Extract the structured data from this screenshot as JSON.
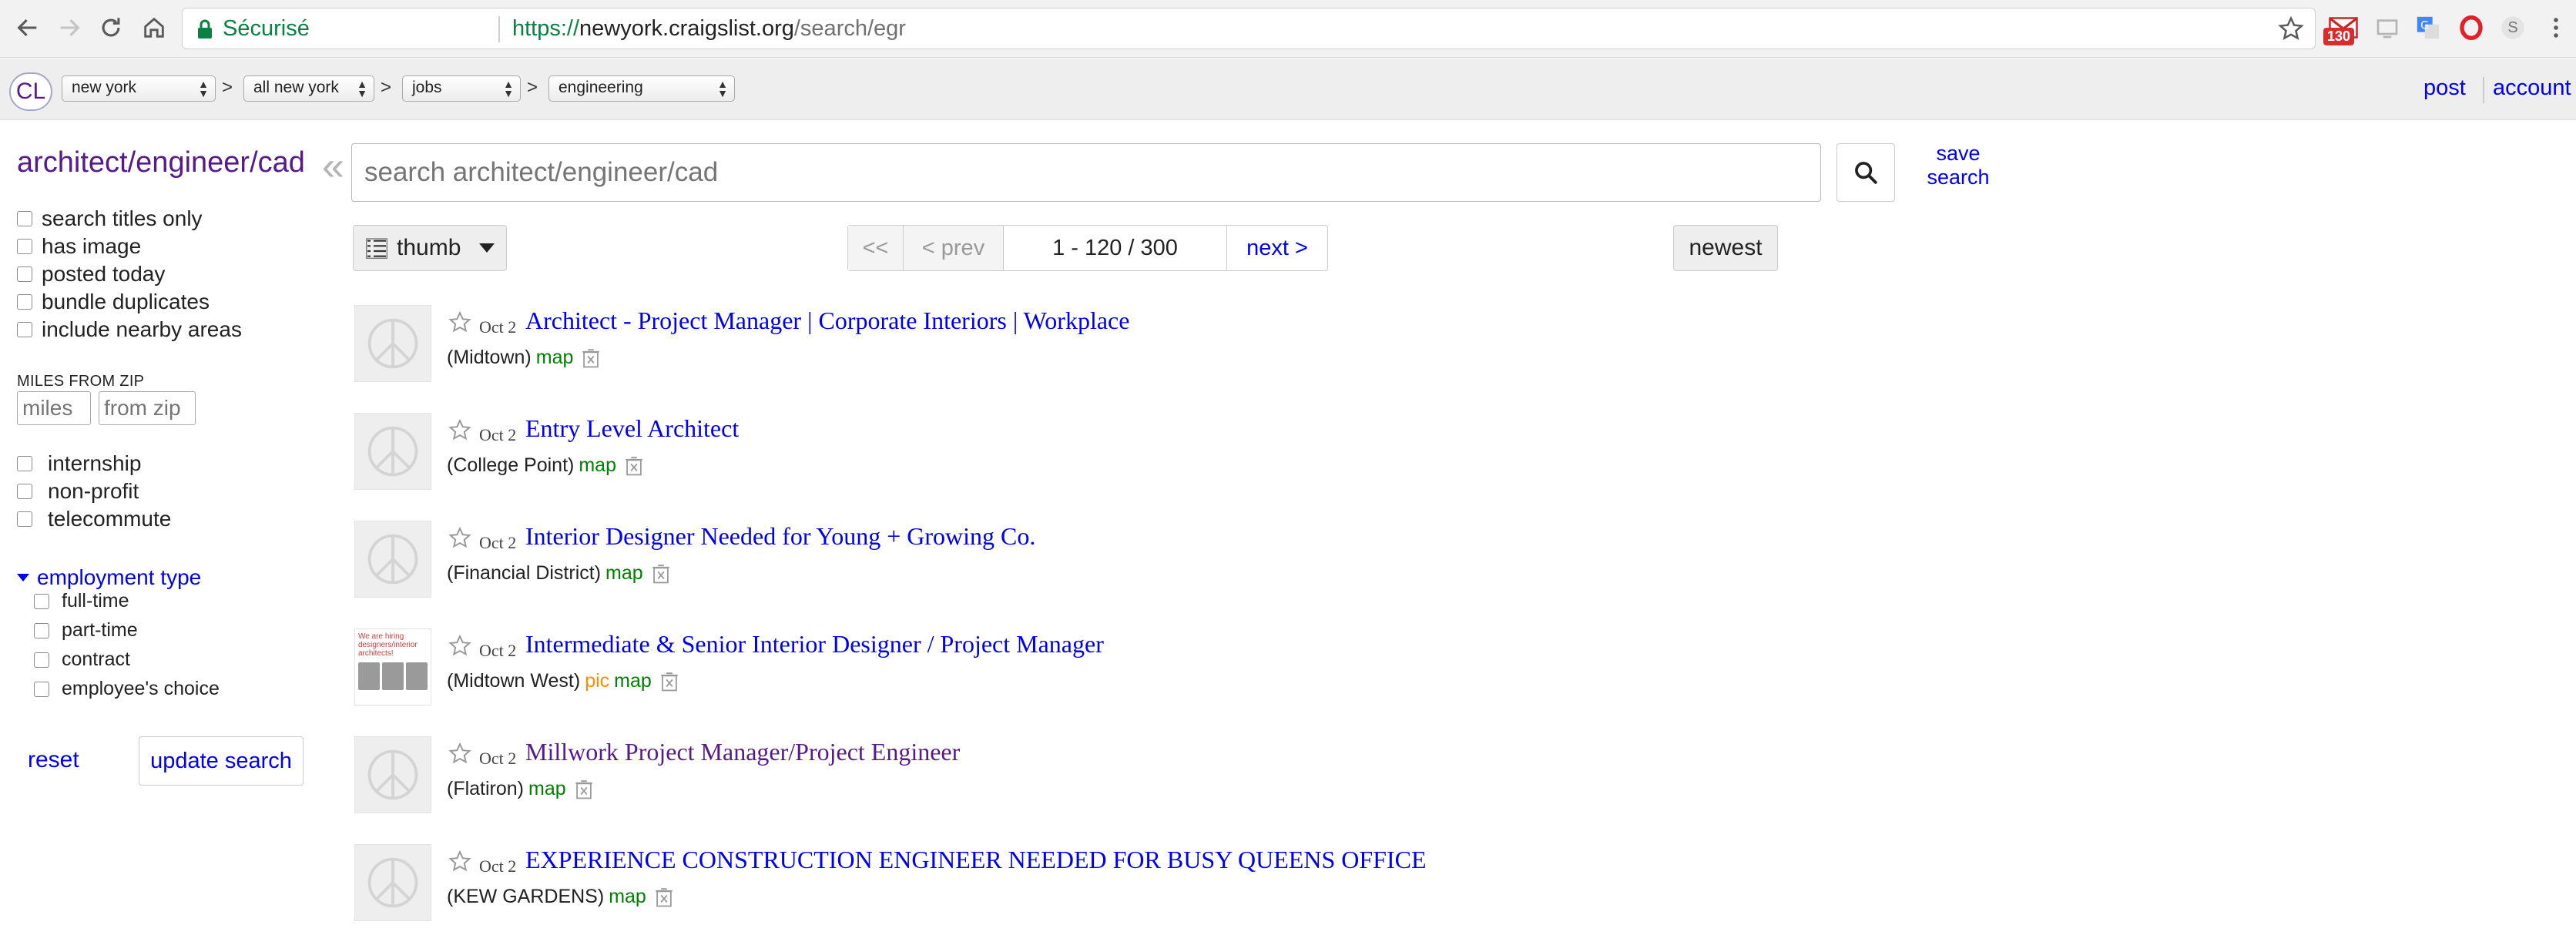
{
  "browser": {
    "secure_label": "Sécurisé",
    "url_scheme": "https://",
    "url_host": "newyork.craigslist.org",
    "url_path": "/search/egr",
    "gmail_count": "130",
    "profile_initial": "S"
  },
  "header": {
    "logo": "CL",
    "breadcrumbs": [
      "new york",
      "all new york",
      "jobs",
      "engineering"
    ],
    "separator": ">",
    "post_label": "post",
    "account_label": "account"
  },
  "sidebar": {
    "title": "architect/engineer/cad",
    "collapse_glyph": "«",
    "filters": [
      "search titles only",
      "has image",
      "posted today",
      "bundle duplicates",
      "include nearby areas"
    ],
    "miles_label": "MILES FROM ZIP",
    "miles_placeholder": "miles",
    "zip_placeholder": "from zip",
    "job_filters": [
      "internship",
      "non-profit",
      "telecommute"
    ],
    "employment_type_label": "employment type",
    "employment_types": [
      "full-time",
      "part-time",
      "contract",
      "employee's choice"
    ],
    "reset_label": "reset",
    "update_label": "update search"
  },
  "search": {
    "placeholder": "search architect/engineer/cad",
    "save_label": "save search"
  },
  "toolbar": {
    "view_mode": "thumb",
    "pager_first": "<<",
    "pager_prev": "< prev",
    "pager_range": "1 - 120 / 300",
    "pager_next": "next >",
    "sort": "newest"
  },
  "results": [
    {
      "date": "Oct 2",
      "title": "Architect - Project Manager | Corporate Interiors | Workplace",
      "location": "(Midtown)",
      "pic": "",
      "map": "map",
      "visited": false,
      "has_image": false
    },
    {
      "date": "Oct 2",
      "title": "Entry Level Architect",
      "location": "(College Point)",
      "pic": "",
      "map": "map",
      "visited": false,
      "has_image": false
    },
    {
      "date": "Oct 2",
      "title": "Interior Designer Needed for Young + Growing Co.",
      "location": "(Financial District)",
      "pic": "",
      "map": "map",
      "visited": false,
      "has_image": false
    },
    {
      "date": "Oct 2",
      "title": "Intermediate & Senior Interior Designer / Project Manager",
      "location": "(Midtown West)",
      "pic": "pic",
      "map": "map",
      "visited": false,
      "has_image": true
    },
    {
      "date": "Oct 2",
      "title": "Millwork Project Manager/Project Engineer",
      "location": "(Flatiron)",
      "pic": "",
      "map": "map",
      "visited": true,
      "has_image": false
    },
    {
      "date": "Oct 2",
      "title": "EXPERIENCE CONSTRUCTION ENGINEER NEEDED FOR BUSY QUEENS OFFICE",
      "location": "(KEW GARDENS)",
      "pic": "",
      "map": "map",
      "visited": false,
      "has_image": false
    }
  ],
  "thumb_text": "We are hiring designers/interior architects!"
}
